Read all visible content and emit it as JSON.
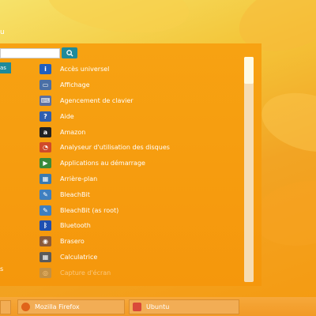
{
  "desktop": {
    "top_label": "u",
    "bottom_left_label": "s"
  },
  "menu": {
    "search": {
      "value": "",
      "placeholder": ""
    },
    "search_button_icon": "search-icon",
    "active_category": "as",
    "apps": [
      {
        "label": "Accès universel",
        "icon": "accessibility-icon",
        "color": "#1f5fbf",
        "glyph": "i"
      },
      {
        "label": "Affichage",
        "icon": "display-icon",
        "color": "#4a6fa5",
        "glyph": "▭"
      },
      {
        "label": "Agencement de clavier",
        "icon": "keyboard-icon",
        "color": "#5b6fa0",
        "glyph": "⌨"
      },
      {
        "label": "Aide",
        "icon": "help-icon",
        "color": "#2f5fb0",
        "glyph": "?"
      },
      {
        "label": "Amazon",
        "icon": "amazon-icon",
        "color": "#222222",
        "glyph": "a"
      },
      {
        "label": "Analyseur d'utilisation des disques",
        "icon": "disk-usage-icon",
        "color": "#d04a2a",
        "glyph": "◔"
      },
      {
        "label": "Applications au démarrage",
        "icon": "startup-apps-icon",
        "color": "#3a8a3a",
        "glyph": "▶"
      },
      {
        "label": "Arrière-plan",
        "icon": "background-icon",
        "color": "#3a7ab0",
        "glyph": "▦"
      },
      {
        "label": "BleachBit",
        "icon": "bleachbit-icon",
        "color": "#3f7fbf",
        "glyph": "✎"
      },
      {
        "label": "BleachBit (as root)",
        "icon": "bleachbit-root-icon",
        "color": "#3f7fbf",
        "glyph": "✎"
      },
      {
        "label": "Bluetooth",
        "icon": "bluetooth-icon",
        "color": "#1f4fb0",
        "glyph": "ᛒ"
      },
      {
        "label": "Brasero",
        "icon": "brasero-icon",
        "color": "#8a5a3a",
        "glyph": "◉"
      },
      {
        "label": "Calculatrice",
        "icon": "calculator-icon",
        "color": "#5a5a5a",
        "glyph": "▦"
      },
      {
        "label": "Capture d'écran",
        "icon": "screenshot-icon",
        "color": "#888888",
        "glyph": "◎"
      }
    ]
  },
  "taskbar": {
    "tasks": [
      {
        "label": "Mozilla Firefox",
        "icon": "firefox-icon",
        "color": "#e0641a"
      },
      {
        "label": "Ubuntu",
        "icon": "folder-icon",
        "color": "#d94a3a"
      }
    ]
  }
}
